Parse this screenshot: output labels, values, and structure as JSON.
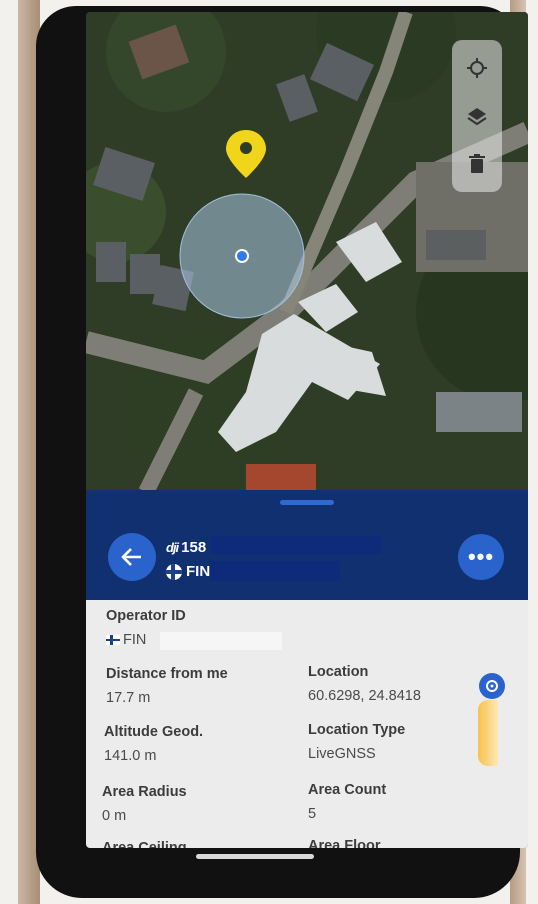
{
  "map": {
    "controls": [
      {
        "icon": "crosshair-icon"
      },
      {
        "icon": "layers-icon"
      },
      {
        "icon": "trash-icon"
      }
    ],
    "marker_icon": "map-pin-icon",
    "user_location_icon": "blue-dot-icon"
  },
  "panel": {
    "brand_logo": "dji",
    "serial_prefix": "158",
    "country": "FIN",
    "back_icon": "arrow-left-icon",
    "more_label": "•••"
  },
  "details": {
    "operator_id_label": "Operator ID",
    "operator_id_value": "FIN",
    "distance_label": "Distance from me",
    "distance_value": "17.7 m",
    "location_label": "Location",
    "location_value": "60.6298, 24.8418",
    "altitude_label": "Altitude Geod.",
    "altitude_value": "141.0 m",
    "location_type_label": "Location Type",
    "location_type_value": "LiveGNSS",
    "area_radius_label": "Area Radius",
    "area_radius_value": "0 m",
    "area_count_label": "Area Count",
    "area_count_value": "5",
    "area_ceiling_label": "Area Ceiling",
    "area_floor_label": "Area Floor"
  },
  "colors": {
    "panel_header": "#10306f",
    "accent": "#2a63cc",
    "panel_body": "#ececec"
  }
}
